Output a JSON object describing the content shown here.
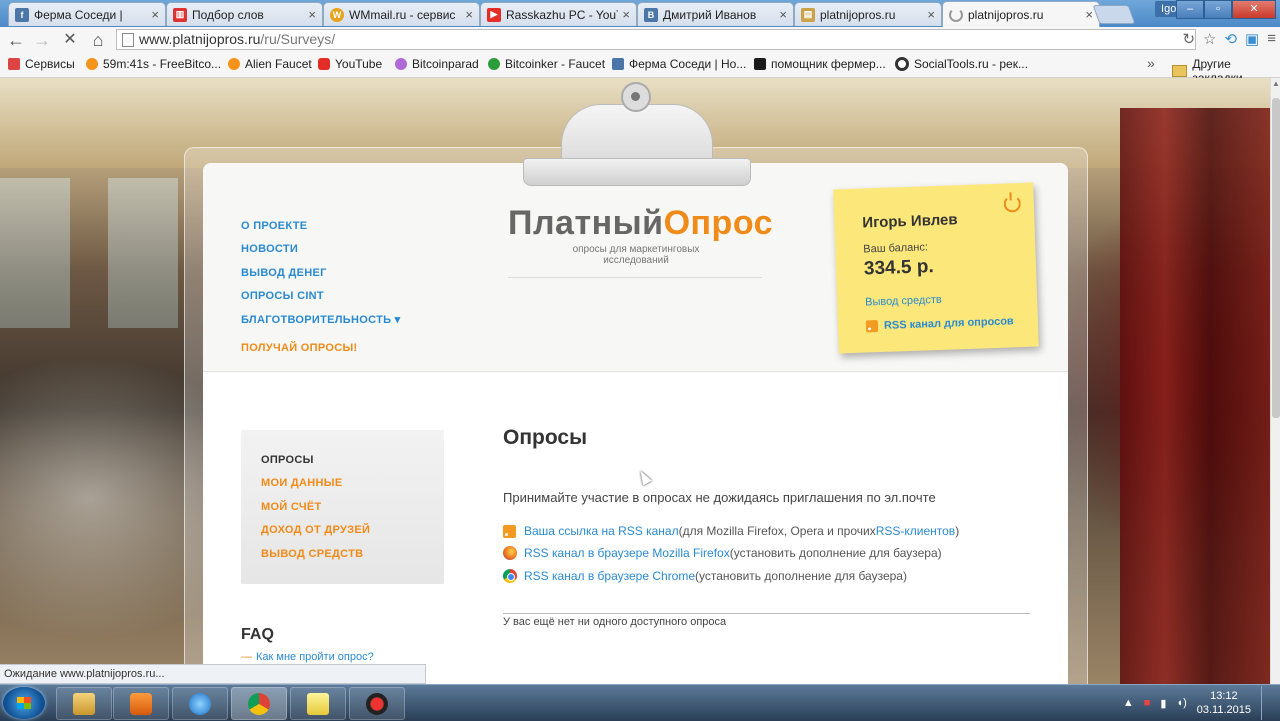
{
  "browser": {
    "tabs": [
      {
        "title": "Ферма Соседи |",
        "icon": "vk-app-icon",
        "color": "#4a76a8"
      },
      {
        "title": "Подбор слов",
        "icon": "chart-icon",
        "color": "#d33"
      },
      {
        "title": "WMmail.ru - сервис",
        "icon": "wmmail-icon",
        "color": "#e8a21c"
      },
      {
        "title": "Rasskazhu PC - YouT",
        "icon": "youtube-icon",
        "color": "#e52d27"
      },
      {
        "title": "Дмитрий Иванов",
        "icon": "vk-icon",
        "color": "#4a76a8"
      },
      {
        "title": "platnijopros.ru",
        "icon": "site-icon",
        "color": "#c9a24a"
      },
      {
        "title": "platnijopros.ru",
        "icon": "loading-icon",
        "color": "#999"
      }
    ],
    "user_badge": "Igor",
    "url_host": "www.platnijopros.ru",
    "url_path": "/ru/Surveys/",
    "bookmarks": [
      {
        "label": "Сервисы",
        "color": "#d44"
      },
      {
        "label": "59m:41s - FreeBitco...",
        "color": "#f7931a"
      },
      {
        "label": "Alien Faucet",
        "color": "#f7931a"
      },
      {
        "label": "YouTube",
        "color": "#e52d27"
      },
      {
        "label": "Bitcoinparad",
        "color": "#b06bd8"
      },
      {
        "label": "Bitcoinker - Faucet",
        "color": "#2a9d3a"
      },
      {
        "label": "Ферма Соседи | Но...",
        "color": "#4a76a8"
      },
      {
        "label": "помощник фермер...",
        "color": "#1a1a1a"
      },
      {
        "label": "SocialTools.ru - рек...",
        "color": "#333"
      }
    ],
    "bookmarks_more": "»",
    "other_bookmarks": "Другие закладки",
    "status_text": "Ожидание www.platnijopros.ru..."
  },
  "site": {
    "nav": [
      {
        "label": "О ПРОЕКТЕ",
        "style": "blue"
      },
      {
        "label": "НОВОСТИ",
        "style": "blue"
      },
      {
        "label": "ВЫВОД ДЕНЕГ",
        "style": "blue"
      },
      {
        "label": "ОПРОСЫ CINT",
        "style": "blue"
      },
      {
        "label": "БЛАГОТВОРИТЕЛЬНОСТЬ ▾",
        "style": "blue"
      },
      {
        "label": "ПОЛУЧАЙ ОПРОСЫ!",
        "style": "orange"
      }
    ],
    "logo": {
      "part1": "Платный",
      "part2": "Опрос",
      "sub1": "опросы для маркетинговых",
      "sub2": "исследований"
    },
    "account": {
      "name": "Игорь Ивлев",
      "balance_label": "Ваш баланс:",
      "balance": "334.5 р.",
      "withdraw": "Вывод средств",
      "rss": "RSS канал для опросов"
    },
    "sidebar": [
      {
        "label": "ОПРОСЫ",
        "current": true
      },
      {
        "label": "МОИ ДАННЫЕ",
        "current": false
      },
      {
        "label": "МОЙ СЧЁТ",
        "current": false
      },
      {
        "label": "ДОХОД ОТ ДРУЗЕЙ",
        "current": false
      },
      {
        "label": "ВЫВОД СРЕДСТВ",
        "current": false
      }
    ],
    "faq": {
      "title": "FAQ",
      "q1": "Как мне пройти опрос?"
    },
    "content": {
      "title": "Опросы",
      "lead": "Принимайте участие в опросах не дожидаясь приглашения по эл.почте",
      "links": [
        {
          "link": "Ваша ссылка на RSS канал",
          "text": " (для Mozilla Firefox, Opera и прочих ",
          "link2": "RSS-клиентов",
          "tail": ")",
          "icon": "rss-icon"
        },
        {
          "link": "RSS канал в браузере Mozilla Firefox",
          "text": " (установить дополнение для баузера)",
          "icon": "firefox-icon"
        },
        {
          "link": "RSS канал в браузере Chrome",
          "text": " (установить дополнение для баузера)",
          "icon": "chrome-icon"
        }
      ],
      "empty": "У вас ещё нет ни одного доступного опроса"
    }
  },
  "taskbar": {
    "time": "13:12",
    "date": "03.11.2015",
    "apps": [
      "explorer-icon",
      "media-player-icon",
      "ie-icon",
      "chrome-icon",
      "sticky-notes-icon",
      "recorder-icon"
    ]
  }
}
